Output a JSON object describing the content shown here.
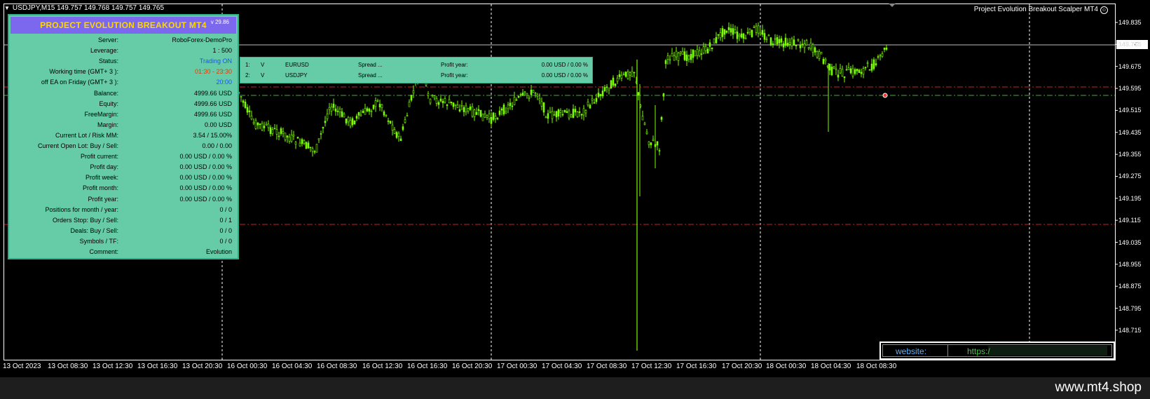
{
  "chart": {
    "title": "USDJPY,M15  149.757 149.768 149.757 149.765",
    "ea_name": "Project Evolution Breakout Scalper MT4",
    "current_price": "149.765",
    "price_labels": [
      "149.835",
      "149.755",
      "149.675",
      "149.595",
      "149.515",
      "149.435",
      "149.355",
      "149.275",
      "149.195",
      "149.115",
      "149.035",
      "148.955",
      "148.875",
      "148.795",
      "148.715"
    ],
    "time_labels": [
      "13 Oct 2023",
      "13 Oct 08:30",
      "13 Oct 12:30",
      "13 Oct 16:30",
      "13 Oct 20:30",
      "16 Oct 00:30",
      "16 Oct 04:30",
      "16 Oct 08:30",
      "16 Oct 12:30",
      "16 Oct 16:30",
      "16 Oct 20:30",
      "17 Oct 00:30",
      "17 Oct 04:30",
      "17 Oct 08:30",
      "17 Oct 12:30",
      "17 Oct 16:30",
      "17 Oct 20:30",
      "18 Oct 00:30",
      "18 Oct 04:30",
      "18 Oct 08:30"
    ],
    "colors": {
      "bull": "#7cfc00",
      "bear": "#7cfc00",
      "grid": "#ffffff",
      "level_red": "#cc2222",
      "level_green": "#44aa44"
    }
  },
  "panel": {
    "title": "PROJECT EVOLUTION BREAKOUT MT4",
    "version": "v 29.86",
    "rows": [
      {
        "label": "Server:",
        "value": "RoboForex-DemoPro",
        "color": "#000000"
      },
      {
        "label": "Leverage:",
        "value": "1 : 500",
        "color": "#000000"
      },
      {
        "label": "Status:",
        "value": "Trading ON",
        "color": "#1e50ff"
      },
      {
        "label": "Working time (GMT+ 3 ):",
        "value": "01:30 - 23:30",
        "color": "#e03c00"
      },
      {
        "label": "off EA on Friday (GMT+ 3 ):",
        "value": "20:00",
        "color": "#1e50ff"
      },
      {
        "label": "Balance:",
        "value": "4999.66 USD",
        "color": "#000000"
      },
      {
        "label": "Equity:",
        "value": "4999.66 USD",
        "color": "#000000"
      },
      {
        "label": "FreeMargin:",
        "value": "4999.66 USD",
        "color": "#000000"
      },
      {
        "label": "Margin:",
        "value": "0.00 USD",
        "color": "#000000"
      },
      {
        "label": "Current Lot / Risk MM:",
        "value": "3.54 / 15.00%",
        "color": "#000000"
      },
      {
        "label": "Current Open Lot: Buy / Sell:",
        "value": "0.00  /  0.00",
        "color": "#000000"
      },
      {
        "label": "Profit current:",
        "value": "0.00 USD / 0.00 %",
        "color": "#000000"
      },
      {
        "label": "Profit day:",
        "value": "0.00 USD / 0.00 %",
        "color": "#000000"
      },
      {
        "label": "Profit week:",
        "value": "0.00 USD / 0.00 %",
        "color": "#000000"
      },
      {
        "label": "Profit month:",
        "value": "0.00 USD / 0.00 %",
        "color": "#000000"
      },
      {
        "label": "Profit year:",
        "value": "0.00 USD / 0.00 %",
        "color": "#000000"
      },
      {
        "label": "Positions for month / year:",
        "value": "0  /  0",
        "color": "#000000"
      },
      {
        "label": "Orders Stop: Buy / Sell:",
        "value": "0  /  1",
        "color": "#000000"
      },
      {
        "label": "Deals: Buy / Sell:",
        "value": "0  /  0",
        "color": "#000000"
      },
      {
        "label": "Symbols / TF:",
        "value": "0  /  0",
        "color": "#000000"
      },
      {
        "label": "Comment:",
        "value": "Evolution",
        "color": "#000000"
      }
    ]
  },
  "symbols": [
    {
      "num": "1:",
      "flag": "V",
      "symbol": "EURUSD",
      "spread": "Spread ...",
      "profit_label": "Profit year:",
      "profit": "0.00 USD / 0.00 %"
    },
    {
      "num": "2:",
      "flag": "V",
      "symbol": "USDJPY",
      "spread": "Spread ...",
      "profit_label": "Profit year:",
      "profit": "0.00 USD / 0.00 %"
    }
  ],
  "website": {
    "label": "website:",
    "url": "https:/"
  },
  "watermark": "www.mt4.shop"
}
